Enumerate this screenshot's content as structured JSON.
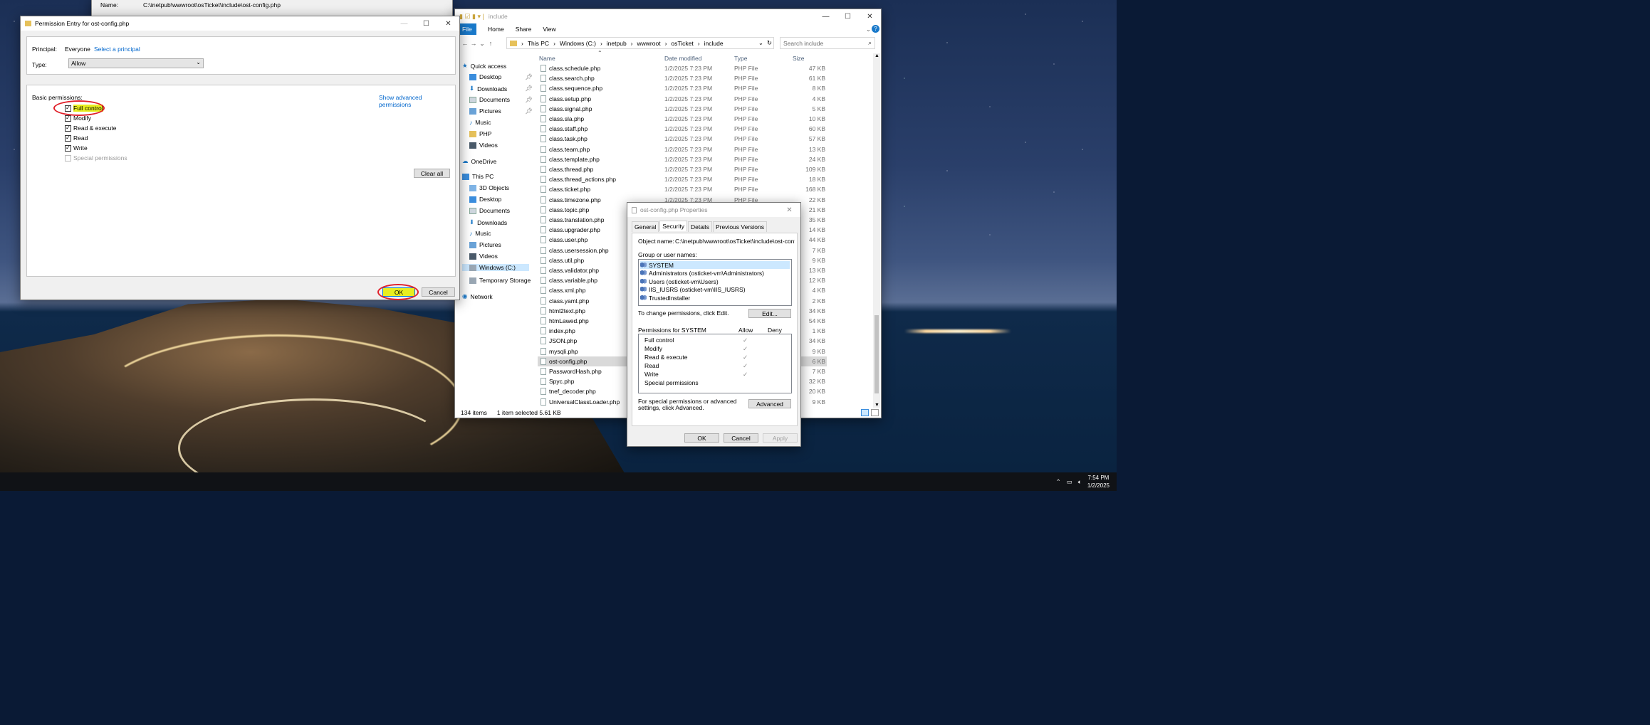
{
  "top_window": {
    "name_label": "Name:",
    "name_value": "C:\\inetpub\\wwwroot\\osTicket\\include\\ost-config.php"
  },
  "perm_dialog": {
    "title": "Permission Entry for ost-config.php",
    "principal_label": "Principal:",
    "principal_value": "Everyone",
    "select_principal": "Select a principal",
    "type_label": "Type:",
    "type_value": "Allow",
    "basic_label": "Basic permissions:",
    "show_advanced": "Show advanced permissions",
    "permissions": [
      {
        "label": "Full control",
        "checked": true
      },
      {
        "label": "Modify",
        "checked": true
      },
      {
        "label": "Read & execute",
        "checked": true
      },
      {
        "label": "Read",
        "checked": true
      },
      {
        "label": "Write",
        "checked": true
      },
      {
        "label": "Special permissions",
        "checked": false
      }
    ],
    "clear_all": "Clear all",
    "ok": "OK",
    "cancel": "Cancel"
  },
  "explorer": {
    "title": "include",
    "ribbon": {
      "file": "File",
      "home": "Home",
      "share": "Share",
      "view": "View"
    },
    "path": [
      "This PC",
      "Windows (C:)",
      "inetpub",
      "wwwroot",
      "osTicket",
      "include"
    ],
    "search_placeholder": "Search include",
    "columns": {
      "name": "Name",
      "date": "Date modified",
      "type": "Type",
      "size": "Size"
    },
    "nav": {
      "quick_access": "Quick access",
      "desktop": "Desktop",
      "downloads": "Downloads",
      "documents": "Documents",
      "pictures": "Pictures",
      "music": "Music",
      "php": "PHP",
      "videos": "Videos",
      "onedrive": "OneDrive",
      "this_pc": "This PC",
      "objects3d": "3D Objects",
      "pc_desktop": "Desktop",
      "pc_documents": "Documents",
      "pc_downloads": "Downloads",
      "pc_music": "Music",
      "pc_pictures": "Pictures",
      "pc_videos": "Videos",
      "windows_c": "Windows (C:)",
      "temp_storage": "Temporary Storage",
      "network": "Network"
    },
    "files": [
      {
        "name": "class.schedule.php",
        "date": "1/2/2025 7:23 PM",
        "type": "PHP File",
        "size": "47 KB"
      },
      {
        "name": "class.search.php",
        "date": "1/2/2025 7:23 PM",
        "type": "PHP File",
        "size": "61 KB"
      },
      {
        "name": "class.sequence.php",
        "date": "1/2/2025 7:23 PM",
        "type": "PHP File",
        "size": "8 KB"
      },
      {
        "name": "class.setup.php",
        "date": "1/2/2025 7:23 PM",
        "type": "PHP File",
        "size": "4 KB"
      },
      {
        "name": "class.signal.php",
        "date": "1/2/2025 7:23 PM",
        "type": "PHP File",
        "size": "5 KB"
      },
      {
        "name": "class.sla.php",
        "date": "1/2/2025 7:23 PM",
        "type": "PHP File",
        "size": "10 KB"
      },
      {
        "name": "class.staff.php",
        "date": "1/2/2025 7:23 PM",
        "type": "PHP File",
        "size": "60 KB"
      },
      {
        "name": "class.task.php",
        "date": "1/2/2025 7:23 PM",
        "type": "PHP File",
        "size": "57 KB"
      },
      {
        "name": "class.team.php",
        "date": "1/2/2025 7:23 PM",
        "type": "PHP File",
        "size": "13 KB"
      },
      {
        "name": "class.template.php",
        "date": "1/2/2025 7:23 PM",
        "type": "PHP File",
        "size": "24 KB"
      },
      {
        "name": "class.thread.php",
        "date": "1/2/2025 7:23 PM",
        "type": "PHP File",
        "size": "109 KB"
      },
      {
        "name": "class.thread_actions.php",
        "date": "1/2/2025 7:23 PM",
        "type": "PHP File",
        "size": "18 KB"
      },
      {
        "name": "class.ticket.php",
        "date": "1/2/2025 7:23 PM",
        "type": "PHP File",
        "size": "168 KB"
      },
      {
        "name": "class.timezone.php",
        "date": "1/2/2025 7:23 PM",
        "type": "PHP File",
        "size": "22 KB"
      },
      {
        "name": "class.topic.php",
        "date": "",
        "type": "",
        "size": "21 KB"
      },
      {
        "name": "class.translation.php",
        "date": "",
        "type": "",
        "size": "35 KB"
      },
      {
        "name": "class.upgrader.php",
        "date": "",
        "type": "",
        "size": "14 KB"
      },
      {
        "name": "class.user.php",
        "date": "",
        "type": "",
        "size": "44 KB"
      },
      {
        "name": "class.usersession.php",
        "date": "",
        "type": "",
        "size": "7 KB"
      },
      {
        "name": "class.util.php",
        "date": "",
        "type": "",
        "size": "9 KB"
      },
      {
        "name": "class.validator.php",
        "date": "",
        "type": "",
        "size": "13 KB"
      },
      {
        "name": "class.variable.php",
        "date": "",
        "type": "",
        "size": "12 KB"
      },
      {
        "name": "class.xml.php",
        "date": "",
        "type": "",
        "size": "4 KB"
      },
      {
        "name": "class.yaml.php",
        "date": "",
        "type": "",
        "size": "2 KB"
      },
      {
        "name": "html2text.php",
        "date": "",
        "type": "",
        "size": "34 KB"
      },
      {
        "name": "htmLawed.php",
        "date": "",
        "type": "",
        "size": "54 KB"
      },
      {
        "name": "index.php",
        "date": "",
        "type": "",
        "size": "1 KB"
      },
      {
        "name": "JSON.php",
        "date": "",
        "type": "",
        "size": "34 KB"
      },
      {
        "name": "mysqli.php",
        "date": "",
        "type": "",
        "size": "9 KB"
      },
      {
        "name": "ost-config.php",
        "date": "",
        "type": "",
        "size": "6 KB"
      },
      {
        "name": "PasswordHash.php",
        "date": "",
        "type": "",
        "size": "7 KB"
      },
      {
        "name": "Spyc.php",
        "date": "",
        "type": "",
        "size": "32 KB"
      },
      {
        "name": "tnef_decoder.php",
        "date": "",
        "type": "",
        "size": "20 KB"
      },
      {
        "name": "UniversalClassLoader.php",
        "date": "",
        "type": "",
        "size": "9 KB"
      }
    ],
    "status_count": "134 items",
    "status_selected": "1 item selected  5.61 KB"
  },
  "props": {
    "title": "ost-config.php Properties",
    "tabs": [
      "General",
      "Security",
      "Details",
      "Previous Versions"
    ],
    "object_name_label": "Object name:",
    "object_name_value": "C:\\inetpub\\wwwroot\\osTicket\\include\\ost-config.p",
    "group_label": "Group or user names:",
    "users": [
      "SYSTEM",
      "Administrators (osticket-vm\\Administrators)",
      "Users (osticket-vm\\Users)",
      "IIS_IUSRS (osticket-vm\\IIS_IUSRS)",
      "TrustedInstaller"
    ],
    "change_text": "To change permissions, click Edit.",
    "edit": "Edit...",
    "perms_for": "Permissions for SYSTEM",
    "allow": "Allow",
    "deny": "Deny",
    "perm_rows": [
      "Full control",
      "Modify",
      "Read & execute",
      "Read",
      "Write",
      "Special permissions"
    ],
    "advanced_text": "For special permissions or advanced settings, click Advanced.",
    "advanced": "Advanced",
    "ok": "OK",
    "cancel": "Cancel",
    "apply": "Apply"
  },
  "taskbar": {
    "time": "7:54 PM",
    "date": "1/2/2025"
  },
  "colors": {
    "accent": "#1979ca",
    "highlight": "#e8ee20",
    "annotation": "#e0202a"
  }
}
